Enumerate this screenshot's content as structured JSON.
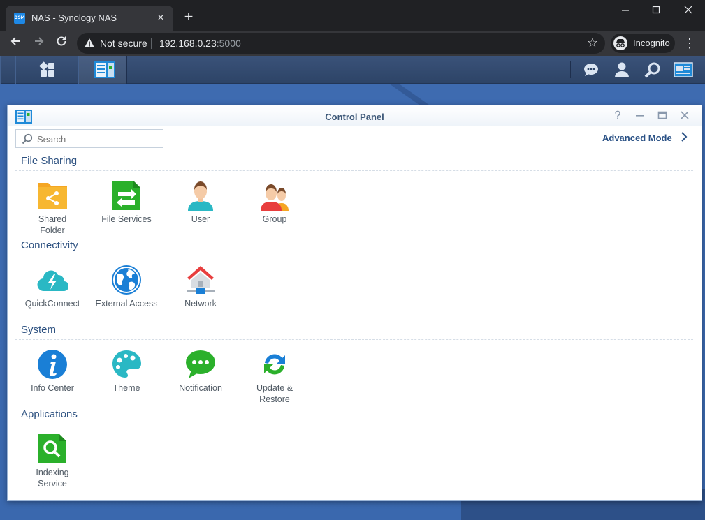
{
  "browser": {
    "tab_title": "NAS - Synology NAS",
    "favicon_text": "DSM",
    "security_label": "Not secure",
    "url_host": "192.168.0.23",
    "url_port": ":5000",
    "profile_label": "Incognito"
  },
  "window": {
    "title": "Control Panel",
    "search_placeholder": "Search",
    "advanced_mode_label": "Advanced Mode"
  },
  "sections": {
    "file_sharing": {
      "title": "File Sharing",
      "items": [
        "Shared\nFolder",
        "File Services",
        "User",
        "Group"
      ]
    },
    "connectivity": {
      "title": "Connectivity",
      "items": [
        "QuickConnect",
        "External Access",
        "Network"
      ]
    },
    "system": {
      "title": "System",
      "items": [
        "Info Center",
        "Theme",
        "Notification",
        "Update &\nRestore"
      ]
    },
    "applications": {
      "title": "Applications",
      "items": [
        "Indexing\nService"
      ]
    }
  },
  "colors": {
    "accent": "#2e5281",
    "desktop": "#3e6bb0",
    "folder": "#f5a623",
    "green": "#2bb02b",
    "blue": "#1a7fd6",
    "teal": "#2ab8c4"
  }
}
